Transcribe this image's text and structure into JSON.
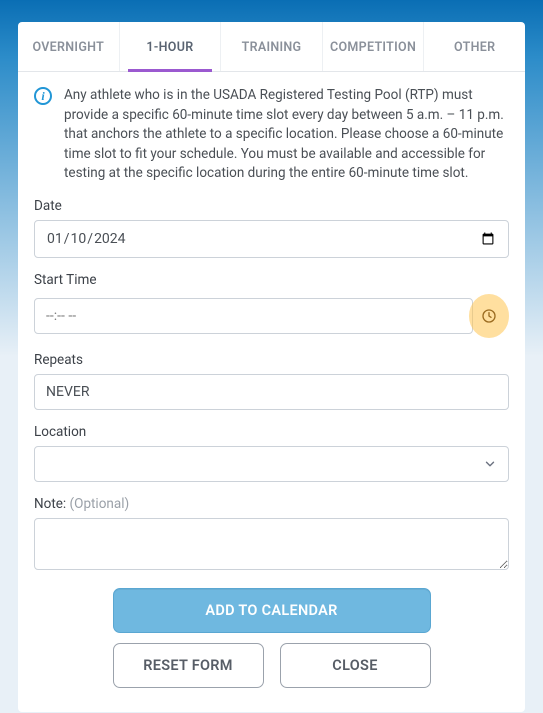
{
  "tabs": {
    "overnight": "OVERNIGHT",
    "one_hour": "1-HOUR",
    "training": "TRAINING",
    "competition": "COMPETITION",
    "other": "OTHER"
  },
  "info": "Any athlete who is in the USADA Registered Testing Pool (RTP) must provide a specific 60-minute time slot every day between 5 a.m. – 11 p.m. that anchors the athlete to a specific location. Please choose a 60-minute time slot to fit your schedule. You must be available and accessible for testing at the specific location during the entire 60-minute time slot.",
  "labels": {
    "date": "Date",
    "start_time": "Start Time",
    "repeats": "Repeats",
    "location": "Location",
    "note": "Note: ",
    "note_optional": "(Optional)"
  },
  "values": {
    "date": "2024-01-10",
    "time_placeholder": "--:-- --",
    "repeats": "NEVER",
    "location": "",
    "note": ""
  },
  "buttons": {
    "add": "ADD TO CALENDAR",
    "reset": "RESET FORM",
    "close": "CLOSE"
  }
}
